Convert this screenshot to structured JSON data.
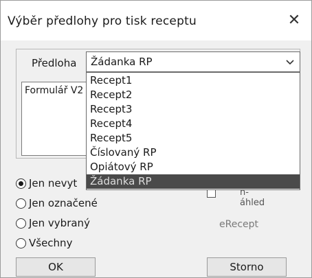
{
  "window": {
    "title": "Výběr předlohy pro tisk receptu",
    "close_symbol": "✕"
  },
  "template": {
    "label": "Předloha",
    "selected_value": "Žádanka RP",
    "options": [
      "Recept1",
      "Recept2",
      "Recept3",
      "Recept4",
      "Recept5",
      "Číslovaný RP",
      "Opiátový RP",
      "Žádanka RP"
    ],
    "highlighted_index": 7
  },
  "form_text": "Formulář V2",
  "print_scope": {
    "options": [
      "Jen nevyt",
      "Jen označené",
      "Jen vybraný",
      "Všechny"
    ],
    "selected_index": 0
  },
  "checkbox_label": "n­áhled",
  "erecept_label": "eRecept",
  "buttons": {
    "ok": "OK",
    "cancel": "Storno"
  },
  "icons": {
    "close": "close-icon",
    "dropdown": "chevron-down-icon"
  }
}
